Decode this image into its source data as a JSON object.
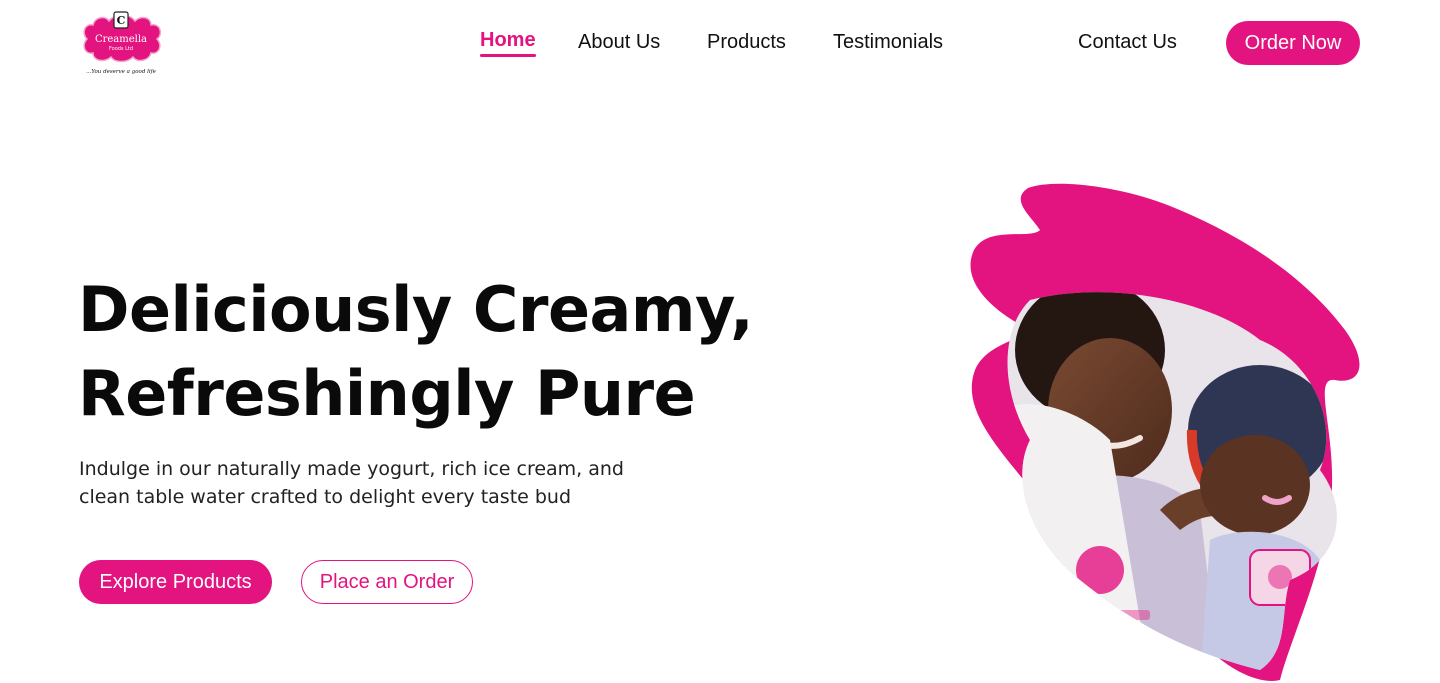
{
  "brand": {
    "name": "Creamella",
    "sub": "Foods Ltd",
    "tagline": "...You deserve a good life",
    "monogram": "C",
    "accent_color": "#e3137f"
  },
  "nav": {
    "items": [
      {
        "label": "Home",
        "active": true
      },
      {
        "label": "About Us",
        "active": false
      },
      {
        "label": "Products",
        "active": false
      },
      {
        "label": "Testimonials",
        "active": false
      },
      {
        "label": "Contact Us",
        "active": false
      }
    ],
    "cta_label": "Order Now"
  },
  "hero": {
    "title_line1": "Deliciously Creamy,",
    "title_line2": "Refreshingly Pure",
    "subtitle_line1": "Indulge in our naturally made yogurt, rich ice cream, and",
    "subtitle_line2": "clean table water crafted to delight every taste bud",
    "primary_button": "Explore Products",
    "secondary_button": "Place an Order"
  }
}
